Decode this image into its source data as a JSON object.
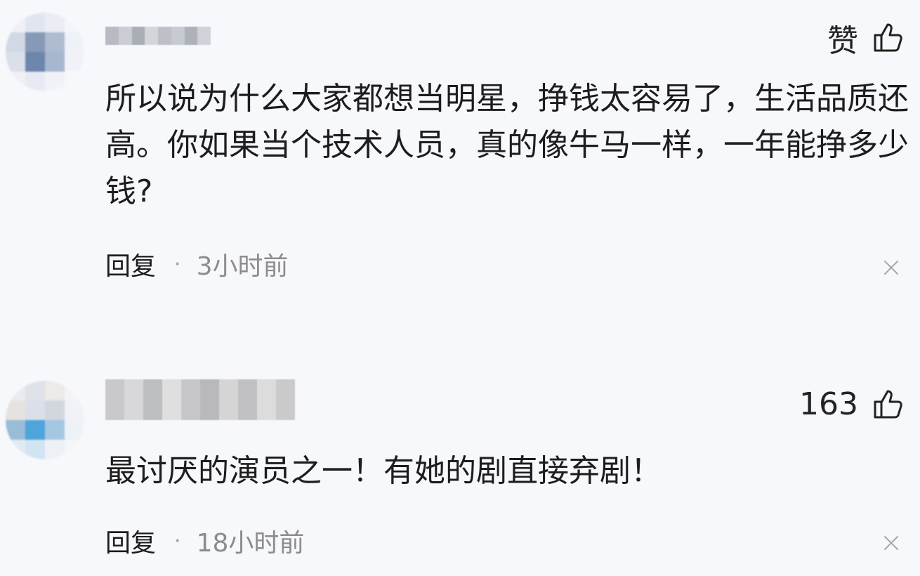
{
  "comments": [
    {
      "like_label": "赞",
      "text": "所以说为什么大家都想当明星，挣钱太容易了，生活品质还高。你如果当个技术人员，真的像牛马一样，一年能挣多少钱?",
      "reply_label": "回复",
      "separator": "·",
      "time": "3小时前",
      "avatar_colors": [
        "#eef0f6",
        "#dfe4ee",
        "#e9ecf4",
        "#f4f5fa",
        "#cfd6e4",
        "#7a8fb0",
        "#a7b5cc",
        "#eef1f8",
        "#d7dde9",
        "#5f7aa3",
        "#9fb0cb",
        "#f1f2f8",
        "#eef0f6",
        "#e6e9f1",
        "#f0f2f8",
        "#f6f7fb"
      ],
      "username_colors": [
        "#b7bac2",
        "#cacdd4",
        "#a9adb6",
        "#d3d5db",
        "#bdc0c8",
        "#c7cad1",
        "#adb1b9",
        "#d0d2d8"
      ]
    },
    {
      "like_count": "163",
      "text": "最讨厌的演员之一！有她的剧直接弃剧！",
      "reply_label": "回复",
      "separator": "·",
      "time": "18小时前",
      "avatar_colors": [
        "#e9eaf0",
        "#dde0e8",
        "#ece9e6",
        "#f4f4f6",
        "#e2e1dd",
        "#d9dde5",
        "#cfd4dc",
        "#f1f2f5",
        "#8fb7d6",
        "#3d9bd9",
        "#9cc3df",
        "#eef1f5",
        "#dfe9f2",
        "#cfe2f0",
        "#edf1f6",
        "#f5f6f9"
      ],
      "username_colors": [
        "#c9c9cc",
        "#d8d8da",
        "#bdbec2",
        "#e0dfe0",
        "#c7c7ca",
        "#b8b9bd",
        "#d6d5d6",
        "#c1c1c4",
        "#dddcdc",
        "#cacacc"
      ]
    }
  ]
}
